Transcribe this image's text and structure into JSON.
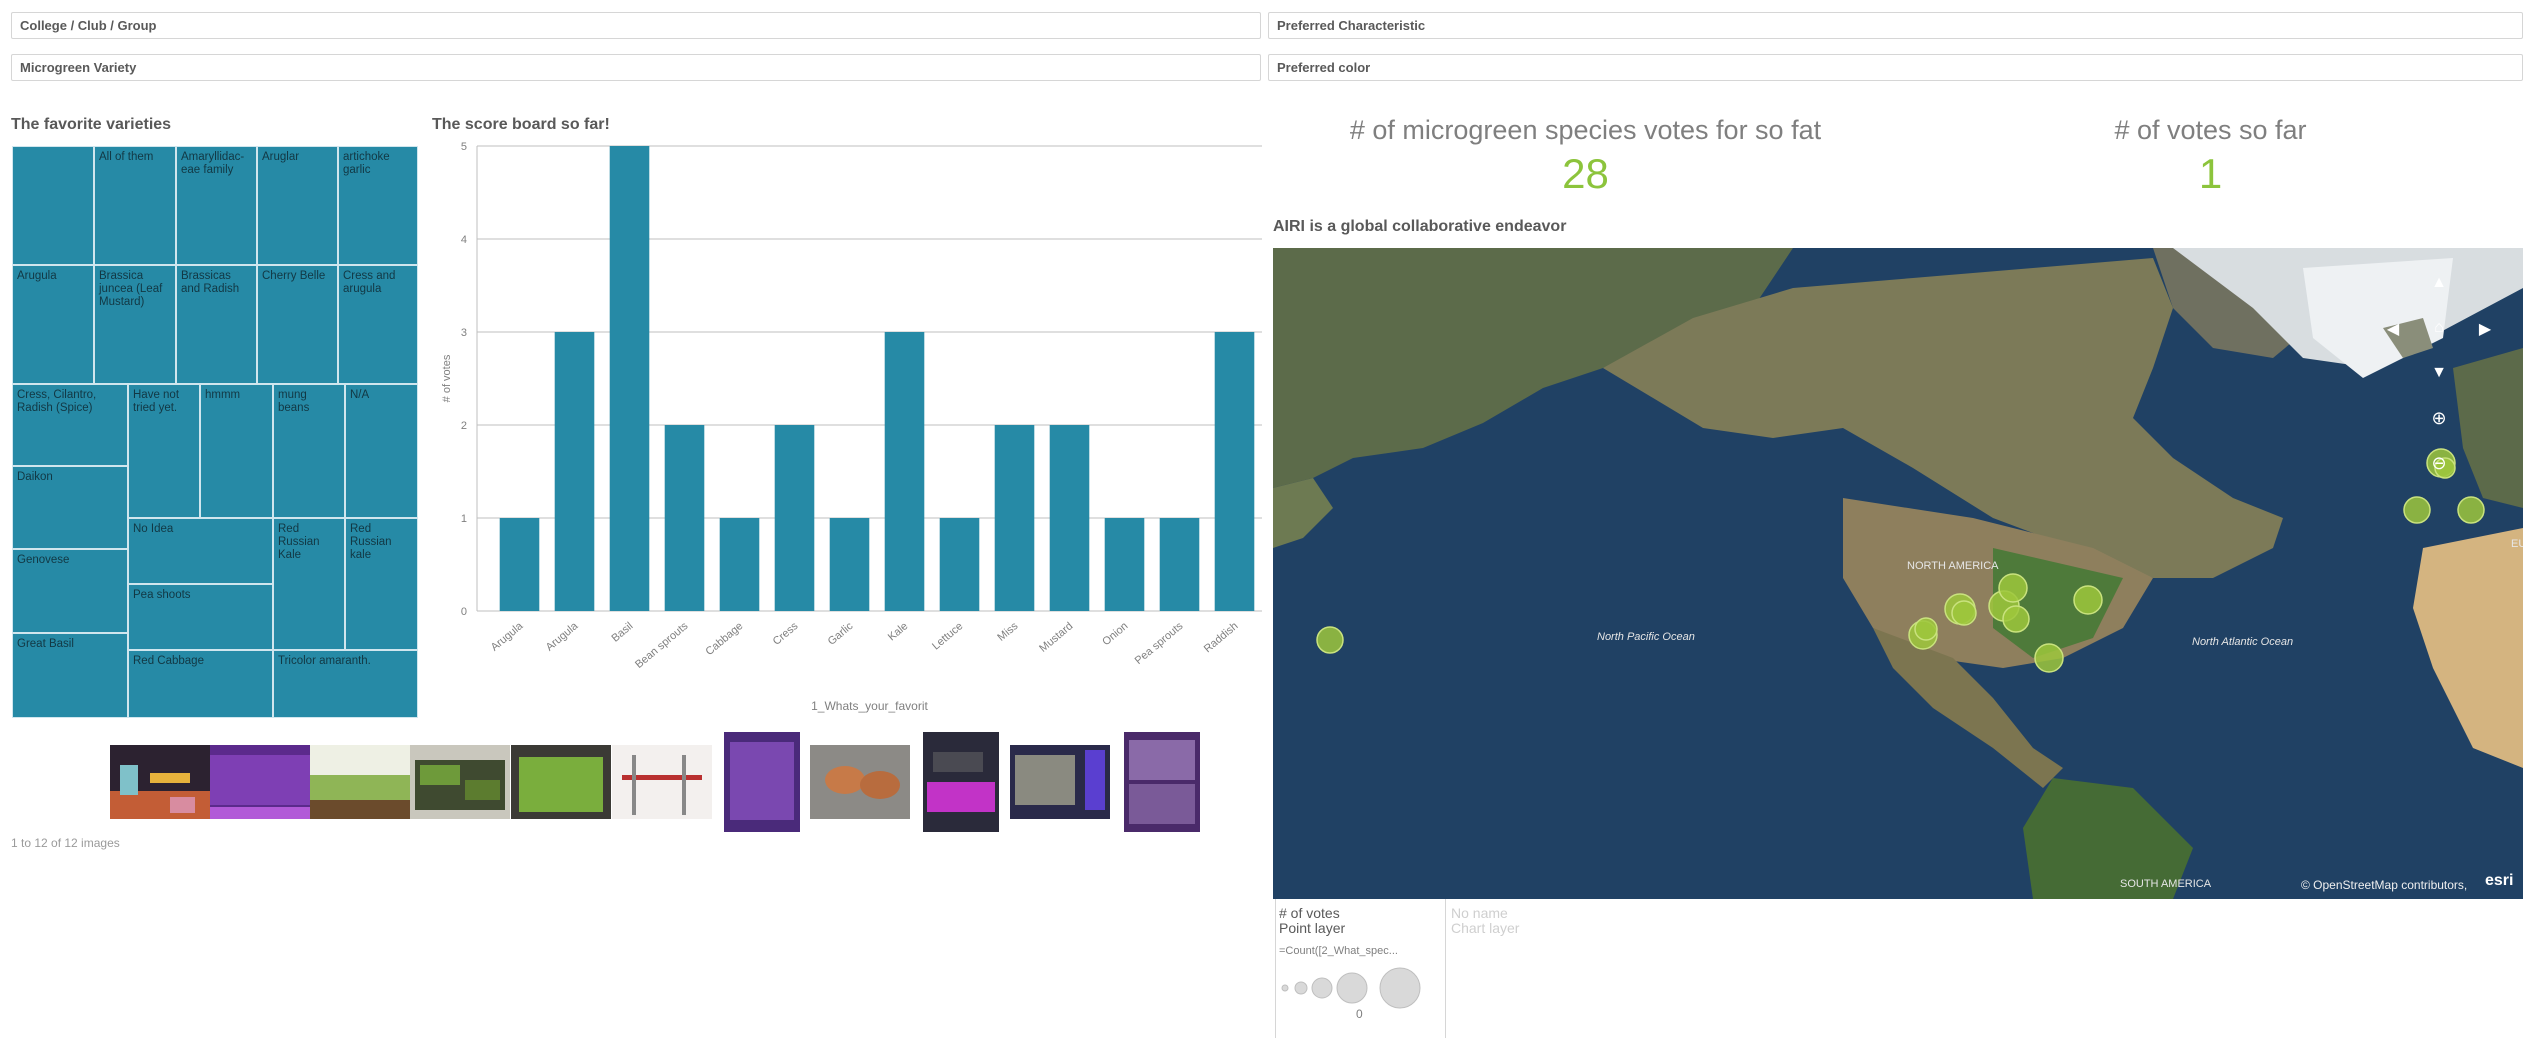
{
  "filters": {
    "college_club_group": "College / Club / Group",
    "microgreen_variety": "Microgreen Variety",
    "preferred_characteristic": "Preferred Characteristic",
    "preferred_color": "Preferred color"
  },
  "treemap": {
    "title": "The favorite varieties",
    "tiles": [
      "",
      "All of them",
      "Amaryllidac-eae family",
      "Aruglar",
      "artichoke garlic",
      "Arugula",
      "Brassica juncea (Leaf Mustard)",
      "Brassicas and Radish",
      "Cherry Belle",
      "Cress and arugula",
      "Cress, Cilantro, Radish (Spice)",
      "Have not tried yet.",
      "hmmm",
      "mung beans",
      "N/A",
      "Daikon",
      "No Idea",
      "Red Russian Kale",
      "Red Russian kale",
      "Genovese",
      "Pea shoots",
      "Great Basil",
      "Red Cabbage",
      "Tricolor amaranth."
    ]
  },
  "barchart": {
    "title": "The score board so far!",
    "ylabel": "# of votes",
    "xlabel": "1_Whats_your_favorit",
    "yticks": [
      "0",
      "1",
      "2",
      "3",
      "4",
      "5"
    ]
  },
  "chart_data": {
    "type": "bar",
    "title": "The score board so far!",
    "xlabel": "1_Whats_your_favorit",
    "ylabel": "# of votes",
    "ylim": [
      0,
      5
    ],
    "grid": true,
    "categories": [
      "Arugula",
      "Arugula",
      "Basil",
      "Bean sprouts",
      "Cabbage",
      "Cress",
      "Garlic",
      "Kale",
      "Lettuce",
      "Miss",
      "Mustard",
      "Onion",
      "Pea sprouts",
      "Raddish"
    ],
    "values": [
      1,
      3,
      5,
      2,
      1,
      2,
      1,
      3,
      1,
      2,
      2,
      1,
      1,
      3
    ]
  },
  "gallery": {
    "caption": "1 to 12 of 12 images"
  },
  "kpis": {
    "species_label": "# of microgreen species votes for so fat",
    "species_value": "28",
    "votes_label": "# of votes so far",
    "votes_value": "1"
  },
  "map": {
    "title": "AIRI is a global collaborative endeavor",
    "labels": {
      "north_america": "NORTH AMERICA",
      "north_pacific": "North Pacific Ocean",
      "north_atlantic": "North Atlantic Ocean",
      "south_america": "SOUTH AMERICA",
      "eu": "EU"
    },
    "attribution": "© OpenStreetMap contributors,",
    "brand": "esri",
    "point_color": "#9dc73c"
  },
  "legend": {
    "layer1_title": "# of votes",
    "layer1_type": "Point layer",
    "measure": "=Count([2_What_spec...",
    "zero": "0",
    "layer2_title": "No name",
    "layer2_type": "Chart layer"
  },
  "colors": {
    "teal": "#268aa6",
    "green": "#8cc43c"
  }
}
